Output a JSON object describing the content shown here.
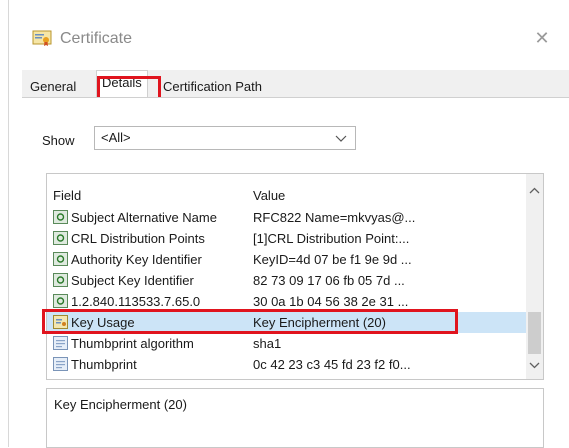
{
  "window": {
    "title": "Certificate"
  },
  "tabs": [
    {
      "label": "General"
    },
    {
      "label": "Details"
    },
    {
      "label": "Certification Path"
    }
  ],
  "show": {
    "label": "Show",
    "value": "<All>"
  },
  "grid": {
    "headers": {
      "field": "Field",
      "value": "Value"
    },
    "rows": [
      {
        "field": "Subject Alternative Name",
        "value": "RFC822 Name=mkvyas@..."
      },
      {
        "field": "CRL Distribution Points",
        "value": "[1]CRL Distribution Point:..."
      },
      {
        "field": "Authority Key Identifier",
        "value": "KeyID=4d 07 be f1 9e 9d ..."
      },
      {
        "field": "Subject Key Identifier",
        "value": "82 73 09 17 06 fb 05 7d ..."
      },
      {
        "field": "1.2.840.113533.7.65.0",
        "value": "30 0a 1b 04 56 38 2e 31 ..."
      },
      {
        "field": "Key Usage",
        "value": "Key Encipherment (20)"
      },
      {
        "field": "Thumbprint algorithm",
        "value": "sha1"
      },
      {
        "field": "Thumbprint",
        "value": "0c 42 23 c3 45 fd 23 f2 f0..."
      }
    ],
    "selected_field": "Key Usage"
  },
  "detail": {
    "text": "Key Encipherment (20)"
  },
  "colors": {
    "highlight": "#e0141e",
    "selection": "#cce4f7"
  }
}
